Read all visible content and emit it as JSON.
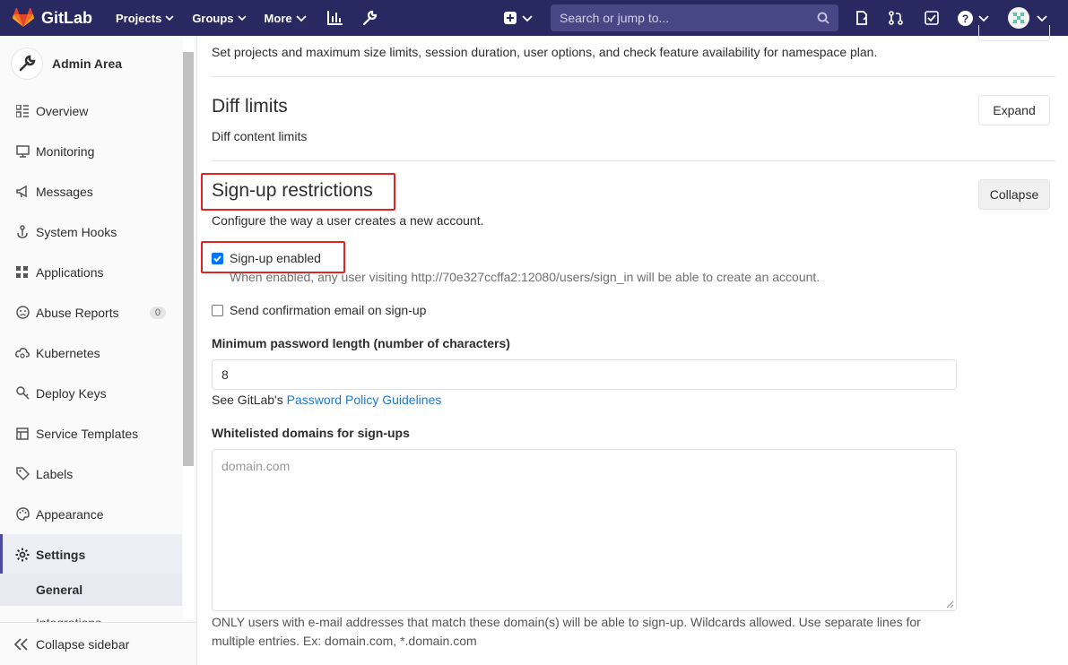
{
  "navbar": {
    "brand": "GitLab",
    "links": [
      {
        "label": "Projects"
      },
      {
        "label": "Groups"
      },
      {
        "label": "More"
      }
    ],
    "search_placeholder": "Search or jump to..."
  },
  "sidebar": {
    "title": "Admin Area",
    "items": [
      {
        "label": "Overview"
      },
      {
        "label": "Monitoring"
      },
      {
        "label": "Messages"
      },
      {
        "label": "System Hooks"
      },
      {
        "label": "Applications"
      },
      {
        "label": "Abuse Reports",
        "count": "0"
      },
      {
        "label": "Kubernetes"
      },
      {
        "label": "Deploy Keys"
      },
      {
        "label": "Service Templates"
      },
      {
        "label": "Labels"
      },
      {
        "label": "Appearance"
      },
      {
        "label": "Settings"
      }
    ],
    "sub_items": [
      {
        "label": "General"
      },
      {
        "label": "Integrations"
      }
    ],
    "collapse_label": "Collapse sidebar"
  },
  "main": {
    "top_description": "Set projects and maximum size limits, session duration, user options, and check feature availability for namespace plan.",
    "diff": {
      "title": "Diff limits",
      "description": "Diff content limits",
      "button": "Expand"
    },
    "signup": {
      "title": "Sign-up restrictions",
      "description": "Configure the way a user creates a new account.",
      "button": "Collapse",
      "signup_enabled_label": "Sign-up enabled",
      "signup_enabled_checked": true,
      "signup_enabled_help": "When enabled, any user visiting http://70e327ccffa2:12080/users/sign_in will be able to create an account.",
      "confirmation_label": "Send confirmation email on sign-up",
      "confirmation_checked": false,
      "min_password_label": "Minimum password length (number of characters)",
      "min_password_value": "8",
      "password_help_prefix": "See GitLab's",
      "password_help_link": "Password Policy Guidelines",
      "whitelist_label": "Whitelisted domains for sign-ups",
      "whitelist_placeholder": "domain.com",
      "whitelist_help_line1": "ONLY users with e-mail addresses that match these domain(s) will be able to sign-up. Wildcards allowed. Use separate lines for",
      "whitelist_help_line2": "multiple entries. Ex: domain.com, *.domain.com"
    }
  },
  "colors": {
    "navbar_bg": "#292961",
    "highlight_border": "#e02424",
    "link": "#1f78d1"
  }
}
